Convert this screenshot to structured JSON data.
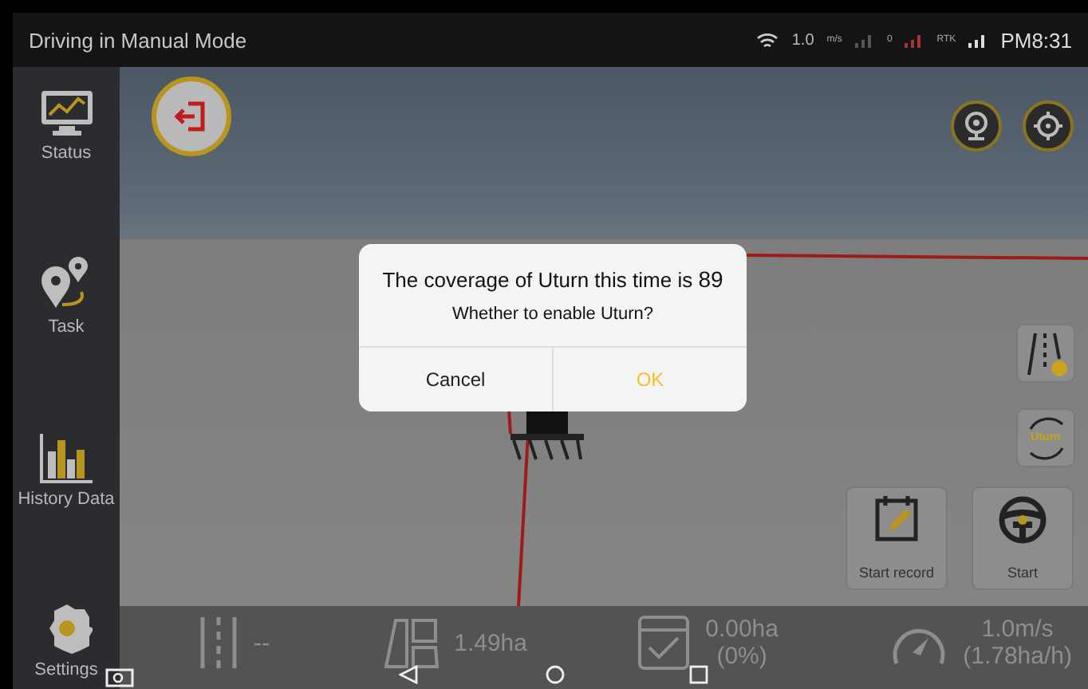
{
  "status_bar": {
    "title": "Driving in Manual Mode",
    "speed": "1.0",
    "speed_unit": "m/s",
    "satellites": "0",
    "rtk": "RTK",
    "time": "PM8:31"
  },
  "sidebar": {
    "items": [
      {
        "kind": "status",
        "label": "Status"
      },
      {
        "kind": "task",
        "label": "Task"
      },
      {
        "kind": "history",
        "label": "History Data"
      },
      {
        "kind": "settings",
        "label": "Settings"
      }
    ]
  },
  "map": {
    "uturn_label": "Uturn",
    "actions": [
      {
        "kind": "record",
        "label": "Start record"
      },
      {
        "kind": "steer",
        "label": "Start"
      }
    ]
  },
  "stats": [
    {
      "kind": "line",
      "value": "--"
    },
    {
      "kind": "area",
      "value": "1.49ha"
    },
    {
      "kind": "done",
      "value": "0.00ha",
      "sub": "(0%)"
    },
    {
      "kind": "speed",
      "value": "1.0m/s",
      "sub": "(1.78ha/h)"
    }
  ],
  "dialog": {
    "message": "The coverage of Uturn this time is",
    "value": "89",
    "question": "Whether to enable Uturn?",
    "buttons": [
      {
        "kind": "cancel",
        "label": "Cancel"
      },
      {
        "kind": "ok",
        "label": "OK"
      }
    ]
  }
}
